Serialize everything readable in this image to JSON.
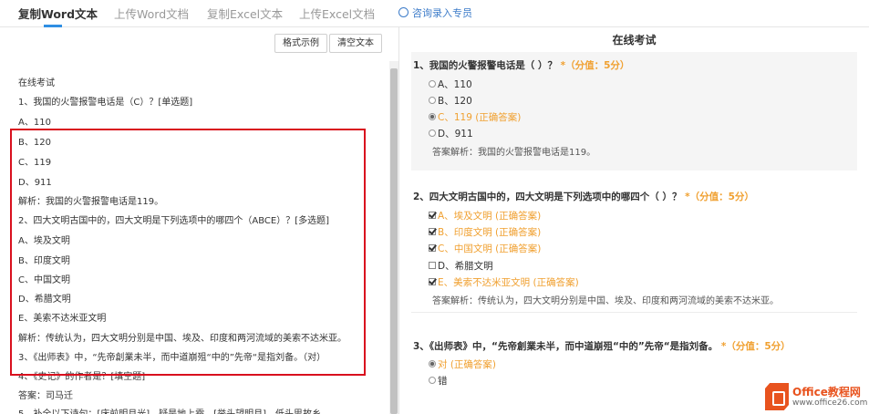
{
  "tabs": [
    {
      "label": "复制Word文本"
    },
    {
      "label": "上传Word文档"
    },
    {
      "label": "复制Excel文本"
    },
    {
      "label": "上传Excel文档"
    }
  ],
  "consult": {
    "label": "咨询录入专员",
    "icon": "headset-icon"
  },
  "left": {
    "format_button": "格式示例",
    "clear_button": "清空文本",
    "lines": [
      "在线考试",
      "1、我国的火警报警电话是（C）？[单选题]",
      "A、110",
      "B、120",
      "C、119",
      "D、911",
      "解析：我国的火警报警电话是119。",
      "2、四大文明古国中的，四大文明是下列选项中的哪四个（ABCE）？[多选题]",
      "A、埃及文明",
      "B、印度文明",
      "C、中国文明",
      "D、希腊文明",
      "E、美索不达米亚文明",
      "解析：传统认为，四大文明分别是中国、埃及、印度和两河流域的美索不达米亚。",
      "3、《出师表》中，“先帝創業未半，而中道崩殂“中的”先帝“是指刘备。（对）",
      "4、《史记》的作者是？[填空题]",
      "答案：司马迁",
      "5、补全以下诗句：[床前明月光]，疑是地上霜。[举头望明月]，低头思故乡。"
    ]
  },
  "right": {
    "title": "在线考试",
    "q1": {
      "title": "1、我国的火警报警电话是（ ）？",
      "score": "*（分值：5分）",
      "options": [
        {
          "text": "A、110",
          "correct": false
        },
        {
          "text": "B、120",
          "correct": false
        },
        {
          "text": "C、119 (正确答案)",
          "correct": true
        },
        {
          "text": "D、911",
          "correct": false
        }
      ],
      "explanation": "答案解析：我国的火警报警电话是119。"
    },
    "q2": {
      "title": "2、四大文明古国中的，四大文明是下列选项中的哪四个（ ）？",
      "score": "*（分值：5分）",
      "options": [
        {
          "text": "A、埃及文明 (正确答案)",
          "correct": true
        },
        {
          "text": "B、印度文明 (正确答案)",
          "correct": true
        },
        {
          "text": "C、中国文明 (正确答案)",
          "correct": true
        },
        {
          "text": "D、希腊文明",
          "correct": false
        },
        {
          "text": "E、美索不达米亚文明 (正确答案)",
          "correct": true
        }
      ],
      "explanation": "答案解析：传统认为，四大文明分别是中国、埃及、印度和两河流域的美索不达米亚。"
    },
    "q3": {
      "title": "3、《出师表》中，“先帝創業未半，而中道崩殂“中的”先帝“是指刘备。",
      "score": "*（分值：5分）",
      "options": [
        {
          "text": "对 (正确答案)",
          "correct": true
        },
        {
          "text": "错",
          "correct": false
        }
      ]
    }
  },
  "logo": {
    "name": "Office教程网",
    "url": "www.office26.com"
  },
  "colors": {
    "accent": "#2f8fe3",
    "correct": "#f0a030",
    "highlight_box": "#d9101e",
    "logo": "#e8531e"
  }
}
